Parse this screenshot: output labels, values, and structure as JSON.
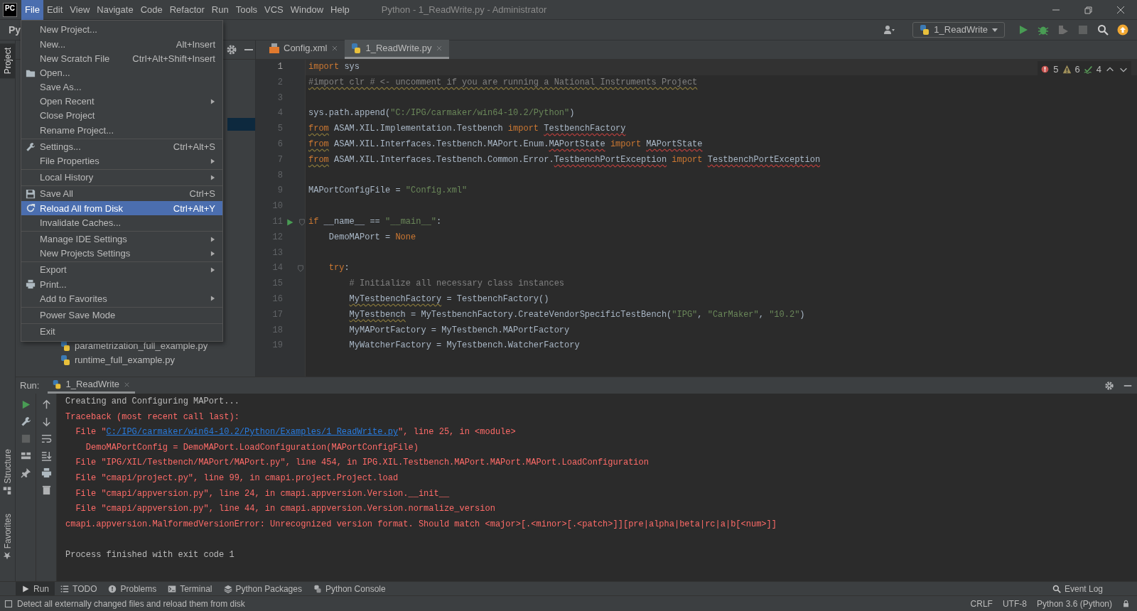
{
  "title_bar": {
    "logo": "PC",
    "title": "Python - 1_ReadWrite.py - Administrator",
    "menu": [
      {
        "label": "File",
        "selected": true
      },
      {
        "label": "Edit",
        "selected": false
      },
      {
        "label": "View",
        "selected": false
      },
      {
        "label": "Navigate",
        "selected": false
      },
      {
        "label": "Code",
        "selected": false
      },
      {
        "label": "Refactor",
        "selected": false
      },
      {
        "label": "Run",
        "selected": false
      },
      {
        "label": "Tools",
        "selected": false
      },
      {
        "label": "VCS",
        "selected": false
      },
      {
        "label": "Window",
        "selected": false
      },
      {
        "label": "Help",
        "selected": false
      }
    ]
  },
  "toolbar": {
    "project_label": "Py",
    "run_config": "1_ReadWrite"
  },
  "left_tool_windows": [
    {
      "label": "Project",
      "selected": true,
      "kind": "project"
    },
    {
      "label": "Structure",
      "selected": false,
      "kind": "structure"
    },
    {
      "label": "Favorites",
      "selected": false,
      "kind": "favorites"
    }
  ],
  "project_tree": {
    "items": [
      {
        "label": "parametrization_full_example.py"
      },
      {
        "label": "runtime_full_example.py"
      }
    ]
  },
  "file_menu": {
    "groups": [
      {
        "items": [
          {
            "label": "New Project...",
            "submenu": false,
            "selected": false
          },
          {
            "label": "New...",
            "shortcut": "Alt+Insert",
            "submenu": false,
            "selected": false
          },
          {
            "label": "New Scratch File",
            "shortcut": "Ctrl+Alt+Shift+Insert",
            "submenu": false,
            "selected": false
          },
          {
            "label": "Open...",
            "kind": "open",
            "submenu": false,
            "selected": false
          },
          {
            "label": "Save As...",
            "submenu": false,
            "selected": false
          },
          {
            "label": "Open Recent",
            "submenu": true,
            "selected": false
          },
          {
            "label": "Close Project",
            "submenu": false,
            "selected": false
          },
          {
            "label": "Rename Project...",
            "submenu": false,
            "selected": false
          }
        ]
      },
      {
        "items": [
          {
            "label": "Settings...",
            "kind": "settings",
            "shortcut": "Ctrl+Alt+S",
            "submenu": false,
            "selected": false
          },
          {
            "label": "File Properties",
            "submenu": true,
            "selected": false
          }
        ]
      },
      {
        "items": [
          {
            "label": "Local History",
            "submenu": true,
            "selected": false
          }
        ]
      },
      {
        "items": [
          {
            "label": "Save All",
            "kind": "save",
            "shortcut": "Ctrl+S",
            "submenu": false,
            "selected": false
          },
          {
            "label": "Reload All from Disk",
            "kind": "reload",
            "shortcut": "Ctrl+Alt+Y",
            "submenu": false,
            "selected": true
          },
          {
            "label": "Invalidate Caches...",
            "submenu": false,
            "selected": false
          }
        ]
      },
      {
        "items": [
          {
            "label": "Manage IDE Settings",
            "submenu": true,
            "selected": false
          },
          {
            "label": "New Projects Settings",
            "submenu": true,
            "selected": false
          }
        ]
      },
      {
        "items": [
          {
            "label": "Export",
            "submenu": true,
            "selected": false
          },
          {
            "label": "Print...",
            "kind": "print",
            "submenu": false,
            "selected": false
          },
          {
            "label": "Add to Favorites",
            "submenu": true,
            "selected": false
          }
        ]
      },
      {
        "items": [
          {
            "label": "Power Save Mode",
            "submenu": false,
            "selected": false
          }
        ]
      },
      {
        "items": [
          {
            "label": "Exit",
            "submenu": false,
            "selected": false
          }
        ]
      }
    ]
  },
  "editor": {
    "tabs": [
      {
        "label": "Config.xml",
        "kind": "xml",
        "selected": false
      },
      {
        "label": "1_ReadWrite.py",
        "kind": "python",
        "selected": true
      }
    ],
    "inspections": {
      "errors": "5",
      "warnings": "6",
      "weak_warnings": "4"
    },
    "lines": [
      {
        "n": "1",
        "current": true,
        "tokens": [
          {
            "text": "import",
            "kind": "keyword"
          },
          {
            "text": " sys",
            "kind": "text"
          }
        ]
      },
      {
        "n": "2",
        "current": false,
        "tokens": [
          {
            "text": "#import clr # <- uncomment if you are running a National Instruments Project",
            "kind": "comment",
            "warning": true
          }
        ]
      },
      {
        "n": "3",
        "current": false
      },
      {
        "n": "4",
        "current": false,
        "tokens": [
          {
            "text": "sys.path.append(",
            "kind": "text"
          },
          {
            "text": "\"C:/IPG/carmaker/win64-10.2/Python\"",
            "kind": "string"
          },
          {
            "text": ")",
            "kind": "text"
          }
        ]
      },
      {
        "n": "5",
        "current": false,
        "tokens": [
          {
            "text": "from",
            "kind": "keyword",
            "warning": true
          },
          {
            "text": " ASAM.XIL.Implementation.Testbench ",
            "kind": "text"
          },
          {
            "text": "import",
            "kind": "keyword"
          },
          {
            "text": " TestbenchFactory",
            "kind": "text",
            "error": true
          }
        ]
      },
      {
        "n": "6",
        "current": false,
        "tokens": [
          {
            "text": "from",
            "kind": "keyword",
            "warning": true
          },
          {
            "text": " ASAM.XIL.Interfaces.Testbench.MAPort.Enum.",
            "kind": "text"
          },
          {
            "text": "MAPortState",
            "kind": "text",
            "error": true
          },
          {
            "text": " import",
            "kind": "keyword"
          },
          {
            "text": " MAPortState",
            "kind": "text",
            "error": true
          }
        ]
      },
      {
        "n": "7",
        "current": false,
        "tokens": [
          {
            "text": "from",
            "kind": "keyword",
            "warning": true
          },
          {
            "text": " ASAM.XIL.Interfaces.Testbench.Common.Error.",
            "kind": "text"
          },
          {
            "text": "TestbenchPortException",
            "kind": "text",
            "error": true
          },
          {
            "text": " import",
            "kind": "keyword"
          },
          {
            "text": " TestbenchPortException",
            "kind": "text",
            "error": true
          }
        ]
      },
      {
        "n": "8",
        "current": false
      },
      {
        "n": "9",
        "current": false,
        "tokens": [
          {
            "text": "MAPortConfigFile = ",
            "kind": "text"
          },
          {
            "text": "\"Config.xml\"",
            "kind": "string"
          }
        ]
      },
      {
        "n": "10",
        "current": false
      },
      {
        "n": "11",
        "current": false,
        "run_marker": true,
        "fold": true,
        "tokens": [
          {
            "text": "if",
            "kind": "keyword"
          },
          {
            "text": " __name__ == ",
            "kind": "text"
          },
          {
            "text": "\"__main__\"",
            "kind": "string"
          },
          {
            "text": ":",
            "kind": "text"
          }
        ]
      },
      {
        "n": "12",
        "current": false,
        "tokens": [
          {
            "text": "    DemoMAPort = ",
            "kind": "text"
          },
          {
            "text": "None",
            "kind": "constant"
          }
        ]
      },
      {
        "n": "13",
        "current": false
      },
      {
        "n": "14",
        "current": false,
        "fold": true,
        "tokens": [
          {
            "text": "    try",
            "kind": "keyword"
          },
          {
            "text": ":",
            "kind": "text"
          }
        ]
      },
      {
        "n": "15",
        "current": false,
        "tokens": [
          {
            "text": "        # Initialize all necessary class instances",
            "kind": "comment"
          }
        ]
      },
      {
        "n": "16",
        "current": false,
        "tokens": [
          {
            "text": "        MyTestbenchFactory",
            "kind": "text",
            "warning": true
          },
          {
            "text": " = TestbenchFactory()",
            "kind": "text"
          }
        ]
      },
      {
        "n": "17",
        "current": false,
        "tokens": [
          {
            "text": "        MyTestbench",
            "kind": "text",
            "warning": true
          },
          {
            "text": " = MyTestbenchFactory.CreateVendorSpecificTestBench(",
            "kind": "text"
          },
          {
            "text": "\"IPG\"",
            "kind": "string"
          },
          {
            "text": ", ",
            "kind": "text"
          },
          {
            "text": "\"CarMaker\"",
            "kind": "string"
          },
          {
            "text": ", ",
            "kind": "text"
          },
          {
            "text": "\"10.2\"",
            "kind": "string"
          },
          {
            "text": ")",
            "kind": "text"
          }
        ]
      },
      {
        "n": "18",
        "current": false,
        "tokens": [
          {
            "text": "        MyMAPortFactory = MyTestbench.MAPortFactory",
            "kind": "text"
          }
        ]
      },
      {
        "n": "19",
        "current": false,
        "tokens": [
          {
            "text": "        MyWatcherFactory = MyTestbench.WatcherFactory",
            "kind": "text"
          }
        ]
      }
    ]
  },
  "run_panel": {
    "label": "Run:",
    "tab": "1_ReadWrite",
    "console": [
      {
        "kind": "line",
        "parts": [
          {
            "text": "Creating and Configuring MAPort...",
            "kind": "output"
          }
        ]
      },
      {
        "kind": "line",
        "parts": [
          {
            "text": "Traceback (most recent call last):",
            "kind": "error"
          }
        ]
      },
      {
        "kind": "line",
        "parts": [
          {
            "text": "  File \"",
            "kind": "error"
          },
          {
            "text": "C:/IPG/carmaker/win64-10.2/Python/Examples/1_ReadWrite.py",
            "kind": "link"
          },
          {
            "text": "\", line 25, in <module>",
            "kind": "error"
          }
        ]
      },
      {
        "kind": "line",
        "parts": [
          {
            "text": "    DemoMAPortConfig = DemoMAPort.LoadConfiguration(MAPortConfigFile)",
            "kind": "error"
          }
        ]
      },
      {
        "kind": "line",
        "parts": [
          {
            "text": "  File \"IPG/XIL/Testbench/MAPort/MAPort.py\", line 454, in IPG.XIL.Testbench.MAPort.MAPort.MAPort.LoadConfiguration",
            "kind": "error"
          }
        ]
      },
      {
        "kind": "line",
        "parts": [
          {
            "text": "  File \"cmapi/project.py\", line 99, in cmapi.project.Project.load",
            "kind": "error"
          }
        ]
      },
      {
        "kind": "line",
        "parts": [
          {
            "text": "  File \"cmapi/appversion.py\", line 24, in cmapi.appversion.Version.__init__",
            "kind": "error"
          }
        ]
      },
      {
        "kind": "line",
        "parts": [
          {
            "text": "  File \"cmapi/appversion.py\", line 44, in cmapi.appversion.Version.normalize_version",
            "kind": "error"
          }
        ]
      },
      {
        "kind": "line",
        "parts": [
          {
            "text": "cmapi.appversion.MalformedVersionError: Unrecognized version format. Should match <major>[.<minor>[.<patch>]][pre|alpha|beta|rc|a|b[<num>]]",
            "kind": "error"
          }
        ]
      },
      {
        "kind": "blank"
      },
      {
        "kind": "line",
        "parts": [
          {
            "text": "Process finished with exit code 1",
            "kind": "output"
          }
        ]
      }
    ]
  },
  "bottom_tabs": [
    {
      "label": "Run",
      "kind": "run",
      "selected": true
    },
    {
      "label": "TODO",
      "kind": "todo",
      "selected": false
    },
    {
      "label": "Problems",
      "kind": "problems",
      "selected": false
    },
    {
      "label": "Terminal",
      "kind": "terminal",
      "selected": false
    },
    {
      "label": "Python Packages",
      "kind": "packages",
      "selected": false
    },
    {
      "label": "Python Console",
      "kind": "console",
      "selected": false
    }
  ],
  "event_log": "Event Log",
  "status_bar": {
    "message": "Detect all externally changed files and reload them from disk",
    "items": [
      "CRLF",
      "UTF-8",
      "Python 3.6 (Python)"
    ]
  }
}
